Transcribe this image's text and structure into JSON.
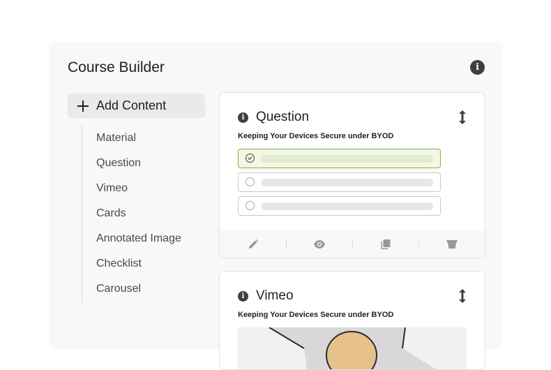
{
  "app": {
    "title": "Course Builder"
  },
  "sidebar": {
    "add_label": "Add Content",
    "items": [
      {
        "label": "Material"
      },
      {
        "label": "Question"
      },
      {
        "label": "Vimeo"
      },
      {
        "label": "Cards"
      },
      {
        "label": "Annotated Image"
      },
      {
        "label": "Checklist"
      },
      {
        "label": "Carousel"
      }
    ]
  },
  "cards": [
    {
      "title": "Question",
      "subtitle": "Keeping Your Devices Secure under BYOD",
      "options": [
        {
          "selected": true
        },
        {
          "selected": false
        },
        {
          "selected": false
        }
      ],
      "toolbar": [
        "edit-icon",
        "preview-icon",
        "duplicate-icon",
        "delete-icon"
      ]
    },
    {
      "title": "Vimeo",
      "subtitle": "Keeping Your Devices Secure under BYOD"
    }
  ],
  "icons": {
    "info": "i"
  },
  "colors": {
    "selected_border": "#8bae3a",
    "selected_fill": "#f2f7e6",
    "icon_dark": "#3f3f42",
    "panel_bg": "#f8f7f9"
  }
}
